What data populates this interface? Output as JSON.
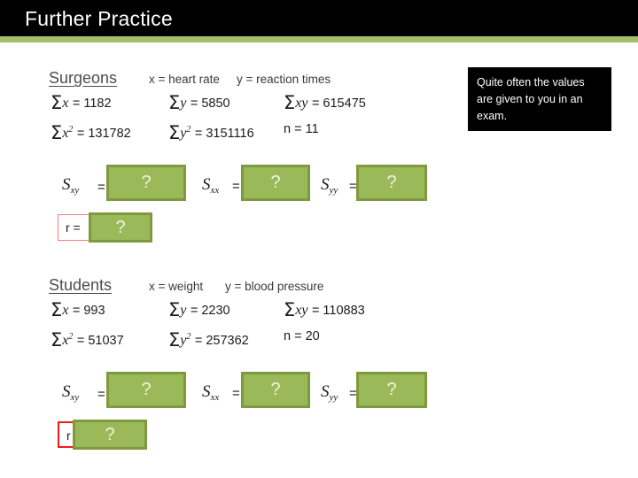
{
  "header": {
    "title": "Further Practice",
    "accent_color": "#a5be6b",
    "bar_color": "#000000"
  },
  "callout": {
    "text": "Quite often the values are given to you in an exam."
  },
  "theme": {
    "box_fill": "#9aba5a",
    "box_border": "#7f9a3e",
    "placeholder": "?"
  },
  "sections": [
    {
      "id": "surgeons",
      "name": "Surgeons",
      "x_label": "x = heart rate",
      "y_label": "y = reaction times",
      "stats": {
        "sum_x_label": "x",
        "sum_x_value": "= 1182",
        "sum_y_label": "y",
        "sum_y_value": "= 5850",
        "sum_xy_label": "xy",
        "sum_xy_value": "= 615475",
        "sum_x2_label": "x",
        "sum_x2_value": "= 131782",
        "sum_y2_label": "y",
        "sum_y2_value": "= 3151116",
        "n_text": "n = 11"
      },
      "answers": {
        "sxy_label": "S",
        "sxy_sub": "xy",
        "sxx_label": "S",
        "sxx_sub": "xx",
        "syy_label": "S",
        "syy_sub": "yy",
        "equals": "=",
        "sxy_value": "?",
        "sxx_value": "?",
        "syy_value": "?",
        "r_label": "r =",
        "r_value": "?"
      }
    },
    {
      "id": "students",
      "name": "Students",
      "x_label": "x = weight",
      "y_label": "y = blood pressure",
      "stats": {
        "sum_x_label": "x",
        "sum_x_value": "= 993",
        "sum_y_label": "y",
        "sum_y_value": "= 2230",
        "sum_xy_label": "xy",
        "sum_xy_value": "= 110883",
        "sum_x2_label": "x",
        "sum_x2_value": "= 51037",
        "sum_y2_label": "y",
        "sum_y2_value": "= 257362",
        "n_text": "n = 20"
      },
      "answers": {
        "sxy_label": "S",
        "sxy_sub": "xy",
        "sxx_label": "S",
        "sxx_sub": "xx",
        "syy_label": "S",
        "syy_sub": "yy",
        "equals": "=",
        "sxy_value": "?",
        "sxx_value": "?",
        "syy_value": "?",
        "r_label": "r =",
        "r_value": "?"
      }
    }
  ]
}
